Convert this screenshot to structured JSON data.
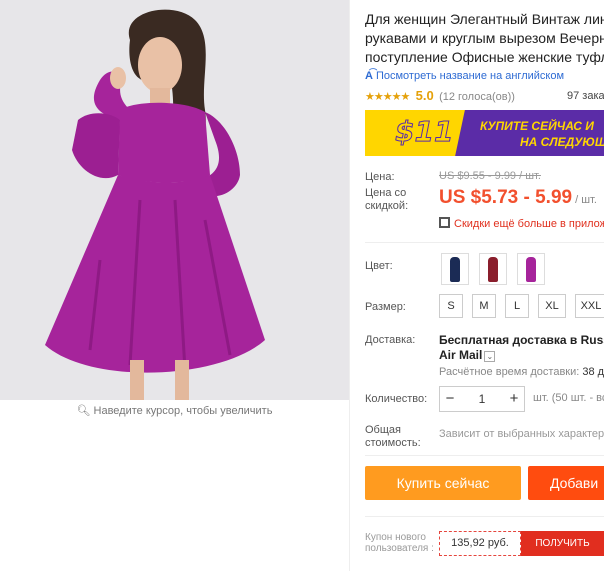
{
  "gallery": {
    "zoom_hint": "Наведите курсор, чтобы увеличить"
  },
  "product": {
    "title_lines": [
      "Для женщин Элегантный Винтаж линии",
      "рукавами и круглым вырезом Вечерни",
      "поступление Офисные женские туфли"
    ],
    "translate_link": "Посмотреть название на английском",
    "translate_icon": "translate-icon",
    "rating": "5.0",
    "votes": "(12 голоса(ов))",
    "orders": "97 заказа(о"
  },
  "promo": {
    "amount": "$11",
    "text_line1": "КУПИТЕ СЕЙЧАС И",
    "text_line2": "НА СЛЕДУЮЩ"
  },
  "price": {
    "label": "Цена:",
    "old": "US $9.55 - 9.99 / шт.",
    "discount_label": "Цена со скидкой:",
    "new": "US $5.73 - 5.99",
    "unit": "/ шт.",
    "discount_link": "Скидки ещё больше в прилож"
  },
  "options": {
    "color_label": "Цвет:",
    "colors": [
      "#1b2b55",
      "#8a1e2c",
      "#a6249b"
    ],
    "size_label": "Размер:",
    "sizes": [
      "S",
      "M",
      "L",
      "XL",
      "XXL"
    ]
  },
  "shipping": {
    "label": "Доставка:",
    "main": "Бесплатная доставка в Russian",
    "service": "Air Mail",
    "time_label": "Расчётное время доставки:",
    "time_value": "38 д"
  },
  "quantity": {
    "label": "Количество:",
    "minus": "−",
    "value": "1",
    "plus": "+",
    "unit": "шт. (50 шт. - вс"
  },
  "total": {
    "label": "Общая стоимость:",
    "note": "Зависит от выбранных характери"
  },
  "actions": {
    "buy_now": "Купить сейчас",
    "add_to_cart": "Добави"
  },
  "coupon": {
    "label": "Купон нового пользователя :",
    "value": "135,92 руб.",
    "button": "ПОЛУЧИТЬ"
  },
  "colors": {
    "price_red": "#f2502e",
    "buy_orange": "#ff9b1f",
    "cart_red": "#ff4c0f",
    "rating_gold": "#e5a10a",
    "link_blue": "#2e6bd3",
    "promo_purple": "#5b2ca7",
    "promo_yellow": "#ffd600",
    "dress_purple": "#a6249b"
  }
}
